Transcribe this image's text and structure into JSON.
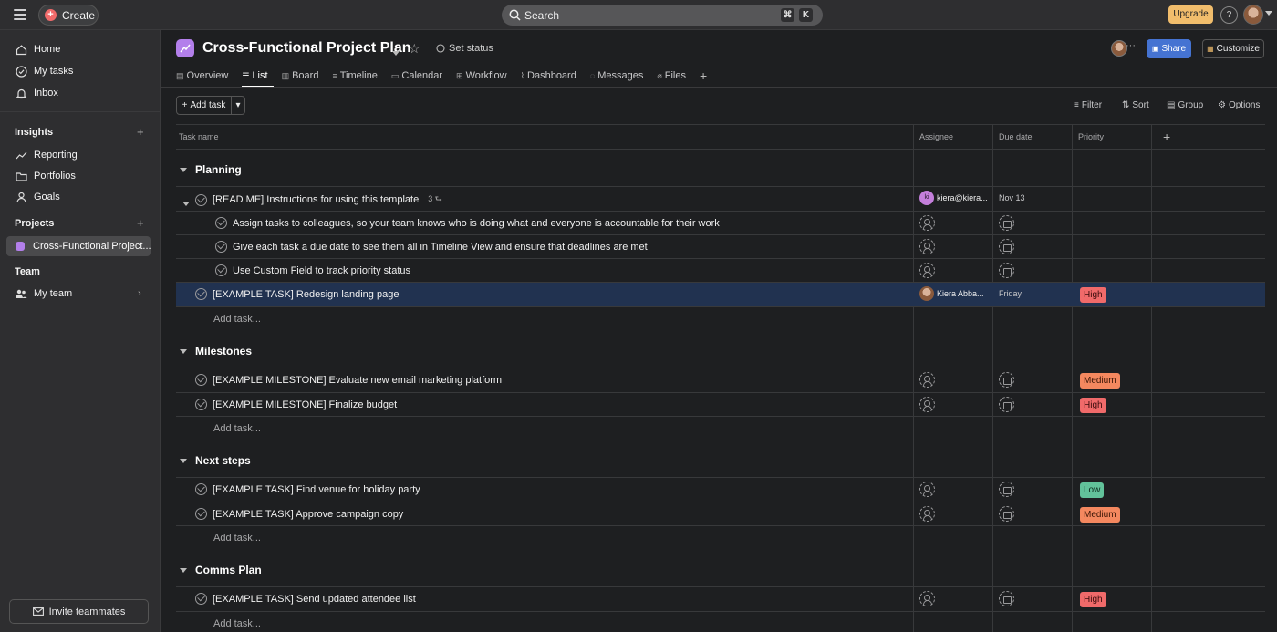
{
  "topbar": {
    "create_label": "Create",
    "search_placeholder": "Search",
    "kbd_cmd": "⌘",
    "kbd_k": "K",
    "upgrade_label": "Upgrade",
    "help_label": "?"
  },
  "sidebar": {
    "nav": [
      {
        "label": "Home",
        "icon": "home-icon"
      },
      {
        "label": "My tasks",
        "icon": "check-circle-icon"
      },
      {
        "label": "Inbox",
        "icon": "bell-icon"
      }
    ],
    "insights_header": "Insights",
    "insights": [
      {
        "label": "Reporting",
        "icon": "chart-icon"
      },
      {
        "label": "Portfolios",
        "icon": "folder-icon"
      },
      {
        "label": "Goals",
        "icon": "person-icon"
      }
    ],
    "projects_header": "Projects",
    "project_name": "Cross-Functional Project...",
    "project_color": "#b37feb",
    "team_header": "Team",
    "team_item": "My team",
    "invite_label": "Invite teammates"
  },
  "project": {
    "title": "Cross-Functional Project Plan",
    "set_status": "Set status",
    "share_label": "Share",
    "customize_label": "Customize"
  },
  "tabs": [
    "Overview",
    "List",
    "Board",
    "Timeline",
    "Calendar",
    "Workflow",
    "Dashboard",
    "Messages",
    "Files"
  ],
  "toolbar": {
    "add_task": "Add task",
    "filter": "Filter",
    "sort": "Sort",
    "group": "Group",
    "options": "Options"
  },
  "columns": {
    "task_name": "Task name",
    "assignee": "Assignee",
    "due_date": "Due date",
    "priority": "Priority"
  },
  "add_task_link": "Add task...",
  "sections": {
    "planning": {
      "title": "Planning",
      "tasks": [
        {
          "name": "[READ ME] Instructions for using this template",
          "subtasks": "3",
          "assignee": "kiera@kiera...",
          "assignee_initials": "ki",
          "due": "Nov 13",
          "priority": ""
        },
        {
          "name": "Assign tasks to colleagues, so your team knows who is doing what and everyone is accountable for their work"
        },
        {
          "name": "Give each task a due date to see them all in Timeline View and ensure that deadlines are met"
        },
        {
          "name": "Use Custom Field to track priority status"
        },
        {
          "name": "[EXAMPLE TASK] Redesign landing page",
          "assignee": "Kiera Abba...",
          "due": "Friday",
          "priority": "High"
        }
      ]
    },
    "milestones": {
      "title": "Milestones",
      "tasks": [
        {
          "name": "[EXAMPLE MILESTONE] Evaluate new email marketing platform",
          "priority": "Medium"
        },
        {
          "name": "[EXAMPLE MILESTONE] Finalize budget",
          "priority": "High"
        }
      ]
    },
    "next_steps": {
      "title": "Next steps",
      "tasks": [
        {
          "name": "[EXAMPLE TASK] Find venue for holiday party",
          "priority": "Low"
        },
        {
          "name": "[EXAMPLE TASK] Approve campaign copy",
          "priority": "Medium"
        }
      ]
    },
    "comms_plan": {
      "title": "Comms Plan",
      "tasks": [
        {
          "name": "[EXAMPLE TASK] Send updated attendee list",
          "priority": "High"
        }
      ]
    }
  },
  "colors": {
    "high": "#f06a6a",
    "medium": "#f4885f",
    "low": "#62c29a",
    "accent": "#4573d2"
  }
}
